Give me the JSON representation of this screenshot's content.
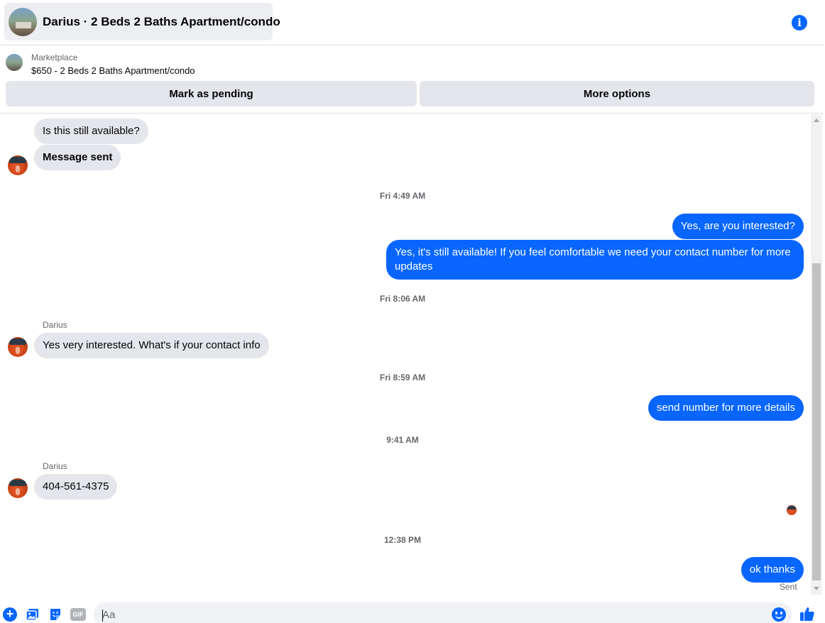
{
  "header": {
    "title": "Darius · 2 Beds 2 Baths Apartment/condo"
  },
  "marketplace": {
    "label": "Marketplace",
    "item": "$650 - 2 Beds 2 Baths Apartment/condo",
    "pending_button": "Mark as pending",
    "more_button": "More options"
  },
  "messages": {
    "m1": "Is this still available?",
    "m2": "Message sent",
    "ts1": "Fri 4:49 AM",
    "m3": "Yes, are you interested?",
    "m4_line1": "Yes, it's still available! If you feel comfortable  we need your contact number for more",
    "m4_line2": "updates",
    "ts2": "Fri 8:06 AM",
    "sender1": "Darius",
    "m5": "Yes very interested. What's if your contact info",
    "ts3": "Fri 8:59 AM",
    "m6": "send number for more details",
    "ts4": "9:41 AM",
    "sender2": "Darius",
    "m7": "404-561-4375",
    "ts5": "12:38 PM",
    "m8": "ok thanks",
    "sent": "Sent"
  },
  "composer": {
    "placeholder": "Aa",
    "gif_label": "GIF"
  },
  "colors": {
    "accent": "#0866ff",
    "incoming_bubble": "#e4e6eb"
  }
}
